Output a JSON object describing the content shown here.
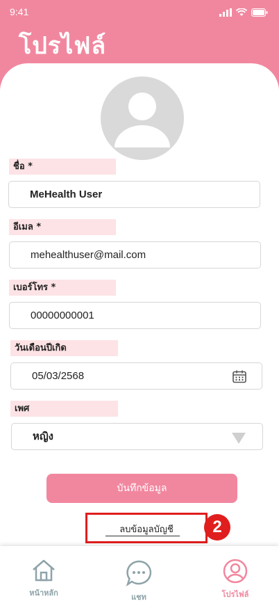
{
  "status_bar": {
    "time": "9:41"
  },
  "page": {
    "title": "โปรไฟล์"
  },
  "form": {
    "name_label": "ชื่อ  *",
    "name_value": "MeHealth User",
    "email_label": "อีเมล *",
    "email_value": "mehealthuser@mail.com",
    "phone_label": "เบอร์โทร *",
    "phone_value": "00000000001",
    "birthdate_label": "วันเดือนปีเกิด",
    "birthdate_value": "05/03/2568",
    "gender_label": "เพศ",
    "gender_value": "หญิง"
  },
  "actions": {
    "save_label": "บันทึกข้อมูล",
    "delete_label": "ลบข้อมูลบัญชี"
  },
  "annotation": {
    "badge": "2",
    "color": "#e01e1e"
  },
  "nav": {
    "home": "หน้าหลัก",
    "chat": "แชท",
    "profile": "โปรไฟล์"
  },
  "colors": {
    "brand": "#f1879f",
    "label_bg": "#fde3e6",
    "nav_inactive": "#8ea3a9"
  }
}
